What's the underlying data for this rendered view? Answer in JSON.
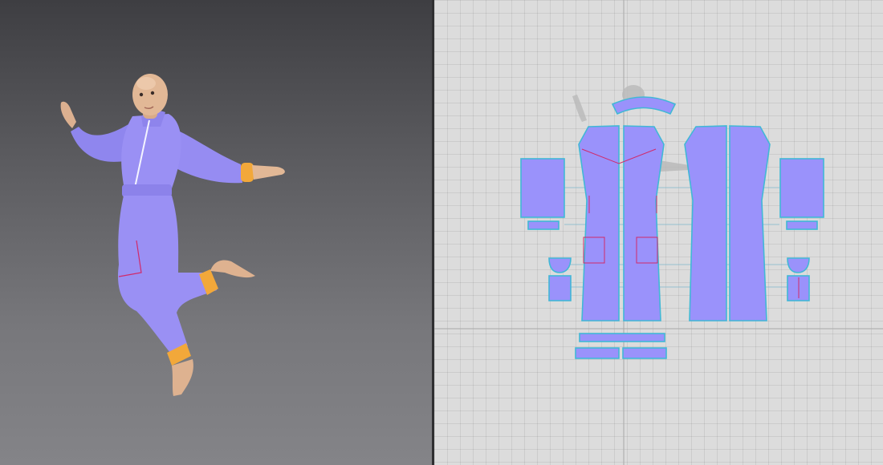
{
  "app": {
    "views": [
      "3d-avatar-view",
      "2d-pattern-view"
    ]
  },
  "colors": {
    "garment": "#9a90f4",
    "garment_shade": "#7c72dc",
    "cuff": "#f2a83a",
    "skin": "#e2b896",
    "pattern_fill": "#9a92fb",
    "pattern_outline": "#41b8d6",
    "seam_line": "#d02a6a",
    "bg_2d": "#dcdcdc"
  },
  "icons": {
    "avatar_silhouette": "avatar-silhouette-icon"
  },
  "pattern_pieces": [
    "collar",
    "front-left-panel",
    "front-right-panel",
    "back-left-panel",
    "back-right-panel",
    "sleeve-left",
    "sleeve-right",
    "cuff-left",
    "cuff-right",
    "pocket-bag-left",
    "pocket-bag-right",
    "pocket-left",
    "pocket-right",
    "waistband",
    "hem-band-left",
    "hem-band-right"
  ]
}
